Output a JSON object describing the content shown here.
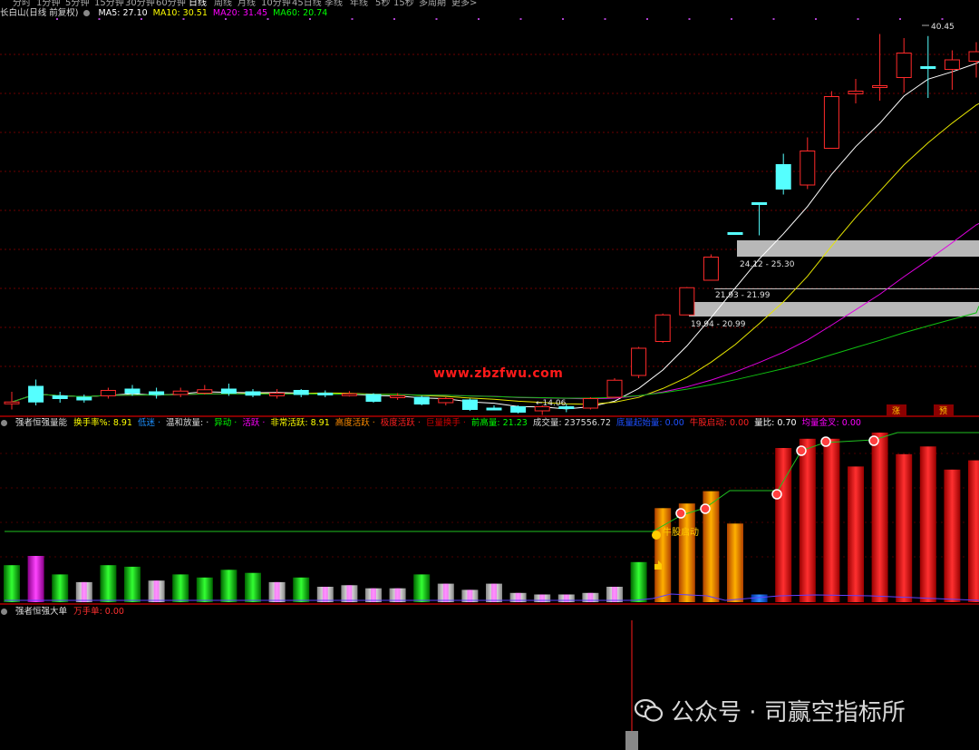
{
  "topbar": {
    "items": [
      "分时",
      "1分钟",
      "5分钟",
      "15分钟",
      "30分钟",
      "60分钟",
      "日线",
      "周线",
      "月线",
      "10分钟",
      "45日线",
      "季线",
      "年线",
      "5秒",
      "15秒",
      "多周期",
      "更多>"
    ]
  },
  "main_panel": {
    "stock_name": "长白山(日线 前复权)",
    "ma": [
      {
        "label": "MA5: 27.10",
        "color": "#ffffff"
      },
      {
        "label": "MA10: 30.51",
        "color": "#ffff00"
      },
      {
        "label": "MA20: 31.45",
        "color": "#ff00ff"
      },
      {
        "label": "MA60: 20.74",
        "color": "#00ff00"
      }
    ],
    "high_label": "40.45",
    "low_label": "←14.06",
    "zones": [
      "24.12 - 25.30",
      "21.93 - 21.99",
      "19.94 - 20.99"
    ],
    "markers": [
      "涨",
      "预"
    ],
    "site_text": "www.zbzfwu.com"
  },
  "volume_panel": {
    "title": "强者恒强量能",
    "fields": [
      {
        "label": "换手率%: 8.91",
        "color": "#ffff00"
      },
      {
        "label": "低迷 ·",
        "color": "#1e90ff"
      },
      {
        "label": "温和放量: ·",
        "color": "#dddddd"
      },
      {
        "label": "异动 ·",
        "color": "#00ff00"
      },
      {
        "label": "活跃 ·",
        "color": "#ff00ff"
      },
      {
        "label": "非常活跃: 8.91",
        "color": "#ffff00"
      },
      {
        "label": "高度活跃 ·",
        "color": "#ff8c00"
      },
      {
        "label": "极度活跃 ·",
        "color": "#ff2020"
      },
      {
        "label": "巨量换手 ·",
        "color": "#cc0000"
      },
      {
        "label": "前高量: 21.23",
        "color": "#00ff00"
      },
      {
        "label": "成交量: 237556.72",
        "color": "#dddddd"
      },
      {
        "label": "底量起始量: 0.00",
        "color": "#1e50ff"
      },
      {
        "label": "牛股启动: 0.00",
        "color": "#ff2020"
      },
      {
        "label": "量比: 0.70",
        "color": "#ffffff"
      },
      {
        "label": "均量金叉: 0.00",
        "color": "#ff00ff"
      }
    ],
    "start_label": "牛股启动"
  },
  "big_order_panel": {
    "title": "强者恒强大单",
    "field": "万手单: 0.00"
  },
  "watermark": "公众号 · 司赢空指标所",
  "chart_data": {
    "type": "candlestick",
    "ylim": [
      13.5,
      41.5
    ],
    "candles": [
      [
        13.45,
        13.55,
        14.3,
        13.0,
        "up"
      ],
      [
        13.55,
        14.7,
        15.2,
        13.3,
        "dn"
      ],
      [
        14.0,
        13.8,
        14.3,
        13.5,
        "dn"
      ],
      [
        13.9,
        13.7,
        14.1,
        13.5,
        "dn"
      ],
      [
        14.0,
        14.4,
        14.6,
        13.8,
        "up"
      ],
      [
        14.5,
        14.2,
        14.8,
        14.0,
        "dn"
      ],
      [
        14.3,
        14.1,
        14.6,
        13.8,
        "dn"
      ],
      [
        14.1,
        14.35,
        14.6,
        13.9,
        "up"
      ],
      [
        14.2,
        14.45,
        14.8,
        14.1,
        "up"
      ],
      [
        14.5,
        14.2,
        14.9,
        14.0,
        "dn"
      ],
      [
        14.3,
        14.05,
        14.5,
        13.9,
        "dn"
      ],
      [
        14.0,
        14.2,
        14.5,
        13.8,
        "up"
      ],
      [
        14.4,
        14.1,
        14.5,
        13.9,
        "dn"
      ],
      [
        14.2,
        14.1,
        14.4,
        13.9,
        "dn"
      ],
      [
        14.05,
        14.15,
        14.35,
        13.95,
        "up"
      ],
      [
        14.1,
        13.6,
        14.2,
        13.5,
        "dn"
      ],
      [
        13.9,
        14.0,
        14.2,
        13.7,
        "up"
      ],
      [
        13.9,
        13.4,
        14.0,
        13.3,
        "dn"
      ],
      [
        13.5,
        13.8,
        13.9,
        13.3,
        "up"
      ],
      [
        13.7,
        13.0,
        13.8,
        12.9,
        "dn"
      ],
      [
        13.1,
        13.1,
        13.3,
        12.95,
        "dn"
      ],
      [
        13.2,
        12.8,
        13.3,
        12.7,
        "dn"
      ],
      [
        12.9,
        13.2,
        13.3,
        12.6,
        "up"
      ],
      [
        13.2,
        13.1,
        13.4,
        12.8,
        "dn"
      ],
      [
        13.1,
        13.8,
        13.9,
        13.0,
        "up"
      ],
      [
        13.9,
        15.15,
        15.3,
        13.9,
        "up"
      ],
      [
        15.5,
        17.5,
        17.6,
        15.3,
        "up"
      ],
      [
        18.0,
        19.95,
        20.05,
        17.9,
        "up"
      ],
      [
        19.95,
        21.95,
        22.0,
        19.95,
        "up"
      ],
      [
        22.5,
        24.2,
        24.4,
        22.5,
        "up"
      ],
      [
        26.0,
        26.0,
        26.0,
        26.0,
        "dn"
      ],
      [
        28.2,
        28.2,
        28.2,
        25.8,
        "dn"
      ],
      [
        31.0,
        29.2,
        31.8,
        28.8,
        "dn"
      ],
      [
        29.5,
        32.0,
        33.0,
        29.2,
        "up"
      ],
      [
        32.2,
        36.0,
        36.4,
        32.2,
        "up"
      ],
      [
        36.4,
        36.2,
        37.3,
        35.5,
        "up"
      ],
      [
        36.8,
        36.8,
        40.6,
        35.7,
        "up"
      ],
      [
        37.4,
        39.2,
        40.3,
        36.3,
        "up"
      ],
      [
        38.2,
        38.2,
        40.45,
        35.9,
        "dn"
      ],
      [
        38.0,
        38.7,
        39.4,
        36.5,
        "up"
      ],
      [
        38.6,
        39.3,
        40.0,
        37.4,
        "up"
      ]
    ],
    "volume": [
      [
        24,
        "g"
      ],
      [
        30,
        "m"
      ],
      [
        18,
        "g"
      ],
      [
        13,
        "w"
      ],
      [
        24,
        "g"
      ],
      [
        23,
        "g"
      ],
      [
        14,
        "w"
      ],
      [
        18,
        "g"
      ],
      [
        16,
        "g"
      ],
      [
        21,
        "g"
      ],
      [
        19,
        "g"
      ],
      [
        13,
        "w"
      ],
      [
        16,
        "g"
      ],
      [
        10,
        "w"
      ],
      [
        11,
        "w"
      ],
      [
        9,
        "w"
      ],
      [
        9,
        "w"
      ],
      [
        18,
        "g"
      ],
      [
        12,
        "w"
      ],
      [
        8,
        "w"
      ],
      [
        12,
        "w"
      ],
      [
        6,
        "w"
      ],
      [
        5,
        "w"
      ],
      [
        5,
        "w"
      ],
      [
        6,
        "w"
      ],
      [
        10,
        "w"
      ],
      [
        26,
        "g"
      ],
      [
        61,
        "o"
      ],
      [
        64,
        "o"
      ],
      [
        72,
        "o"
      ],
      [
        51,
        "o"
      ],
      [
        5,
        "b"
      ],
      [
        100,
        "r"
      ],
      [
        106,
        "r"
      ],
      [
        106,
        "r"
      ],
      [
        88,
        "r"
      ],
      [
        110,
        "r"
      ],
      [
        96,
        "r"
      ],
      [
        101,
        "r"
      ],
      [
        86,
        "r"
      ],
      [
        92,
        "r"
      ]
    ]
  }
}
